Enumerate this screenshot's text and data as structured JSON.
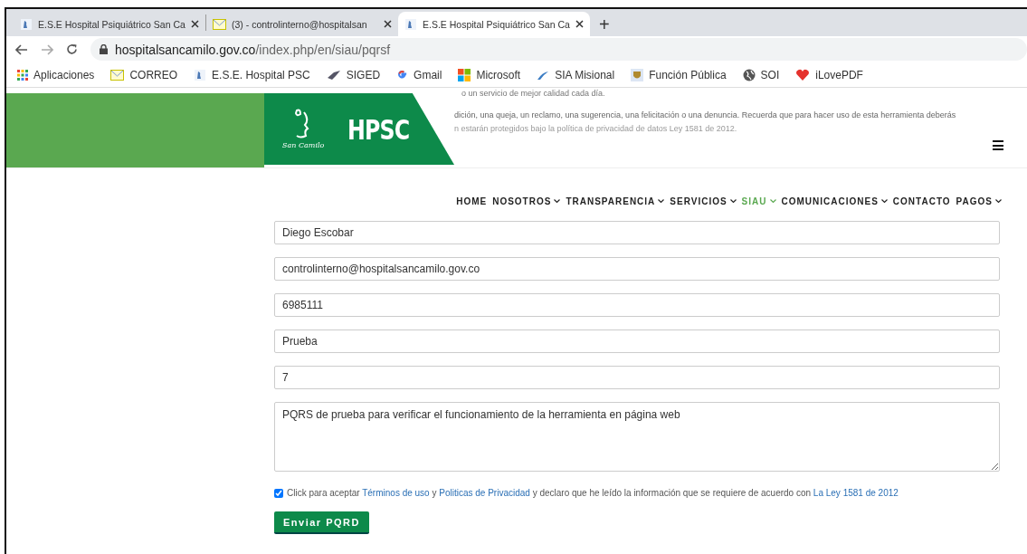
{
  "browser": {
    "tabs": [
      {
        "title": "E.S.E Hospital Psiquiátrico San Ca",
        "kind": "hospital",
        "selected": false
      },
      {
        "title": "(3) - controlinterno@hospitalsan",
        "kind": "mail",
        "selected": false
      },
      {
        "title": "E.S.E Hospital Psiquiátrico San Ca",
        "kind": "hospital",
        "selected": true
      }
    ],
    "new_tab": "+",
    "url_host": "hospitalsancamilo.gov.co",
    "url_path": "/index.php/en/siau/pqrsf",
    "bookmarks": [
      {
        "label": "Aplicaciones",
        "kind": "apps"
      },
      {
        "label": "CORREO",
        "kind": "mail"
      },
      {
        "label": "E.S.E. Hospital PSC",
        "kind": "hospital"
      },
      {
        "label": "SIGED",
        "kind": "siged"
      },
      {
        "label": "Gmail",
        "kind": "google"
      },
      {
        "label": "Microsoft",
        "kind": "microsoft"
      },
      {
        "label": "SIA Misional",
        "kind": "sia"
      },
      {
        "label": "Función Pública",
        "kind": "shield"
      },
      {
        "label": "SOI",
        "kind": "globe"
      },
      {
        "label": "iLovePDF",
        "kind": "heart"
      }
    ]
  },
  "header": {
    "logo_text": "HPSC",
    "logo_script": "San Camilo",
    "intro_lines": [
      "o un servicio de mejor calidad cada día.",
      "dición, una queja, un reclamo, una sugerencia, una felicitación o una denuncia. Recuerda que para hacer uso de esta herramienta deberás",
      "n estarán protegidos bajo la política de privacidad de datos Ley 1581 de 2012."
    ]
  },
  "nav": [
    {
      "label": "HOME",
      "dropdown": false,
      "selected": false
    },
    {
      "label": "NOSOTROS",
      "dropdown": true,
      "selected": false
    },
    {
      "label": "TRANSPARENCIA",
      "dropdown": true,
      "selected": false
    },
    {
      "label": "SERVICIOS",
      "dropdown": true,
      "selected": false
    },
    {
      "label": "SIAU",
      "dropdown": true,
      "selected": true
    },
    {
      "label": "COMUNICACIONES",
      "dropdown": true,
      "selected": false
    },
    {
      "label": "CONTACTO",
      "dropdown": false,
      "selected": false
    },
    {
      "label": "PAGOS",
      "dropdown": true,
      "selected": false
    }
  ],
  "form": {
    "fields": [
      {
        "value": "Diego Escobar"
      },
      {
        "value": "controlinterno@hospitalsancamilo.gov.co"
      },
      {
        "value": "6985111"
      },
      {
        "value": "Prueba"
      },
      {
        "value": "7"
      }
    ],
    "message": "PQRS de prueba para verificar el funcionamiento de la herramienta en página web",
    "consent": {
      "checked": true,
      "parts": [
        {
          "kind": "text",
          "text": "Click para aceptar "
        },
        {
          "kind": "link",
          "text": "Términos de uso"
        },
        {
          "kind": "text",
          "text": " y "
        },
        {
          "kind": "link",
          "text": "Politicas de Privacidad"
        },
        {
          "kind": "text",
          "text": " y declaro que he leído la información que se requiere de acuerdo con "
        },
        {
          "kind": "link",
          "text": "La Ley 1581 de 2012"
        }
      ]
    },
    "submit": "Enviar PQRD"
  }
}
